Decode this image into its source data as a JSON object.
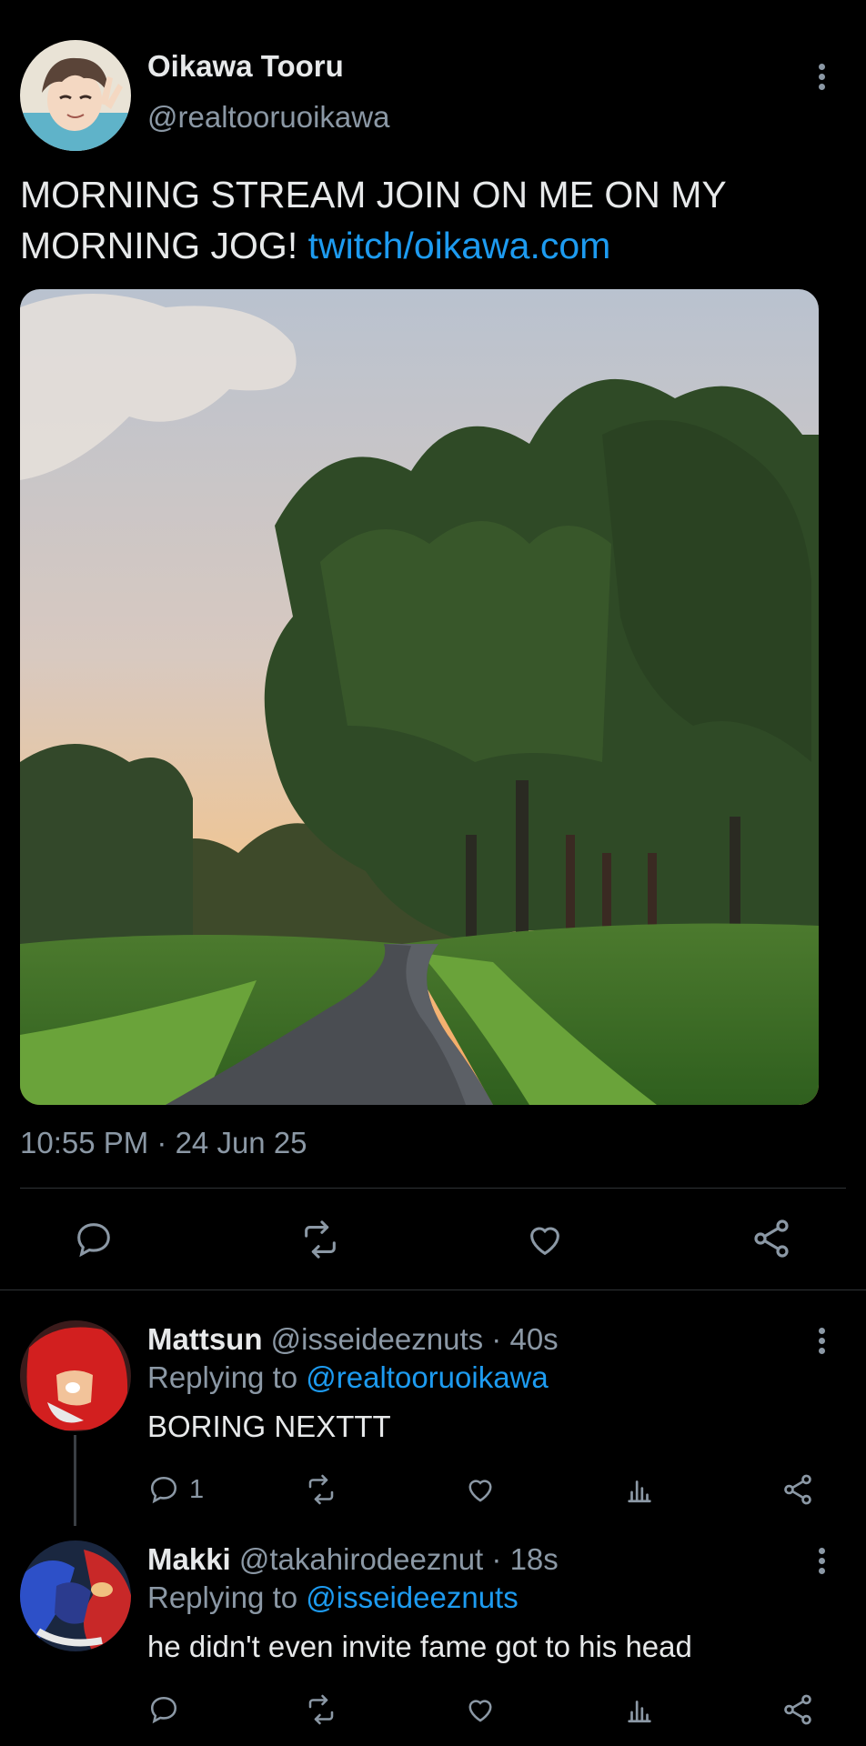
{
  "tweet": {
    "author_name": "Oikawa Tooru",
    "author_handle": "@realtooruoikawa",
    "text": "MORNING STREAM JOIN ON ME ON MY MORNING JOG!",
    "link": "twitch/oikawa.com",
    "timestamp": "10:55 PM · 24 Jun 25",
    "photo_icon": "landscape-photo",
    "actions": [
      "reply-icon",
      "retweet-icon",
      "like-icon",
      "share-icon"
    ]
  },
  "replies": [
    {
      "name": "Mattsun",
      "handle": "@isseideeznuts",
      "sep": "·",
      "time": "40s",
      "replying_prefix": "Replying to",
      "replying_to": "@realtooruoikawa",
      "text": "BORING NEXTTT",
      "reply_count": "1"
    },
    {
      "name": "Makki",
      "handle": "@takahirodeeznut",
      "sep": "·",
      "time": "18s",
      "replying_prefix": "Replying to",
      "replying_to": "@isseideeznuts",
      "text": "he didn't even invite fame got to his head",
      "reply_count": ""
    }
  ],
  "colors": {
    "background": "#000000",
    "accent": "#1d9bf0",
    "muted": "#8b98a5",
    "divider": "#2f3336"
  }
}
